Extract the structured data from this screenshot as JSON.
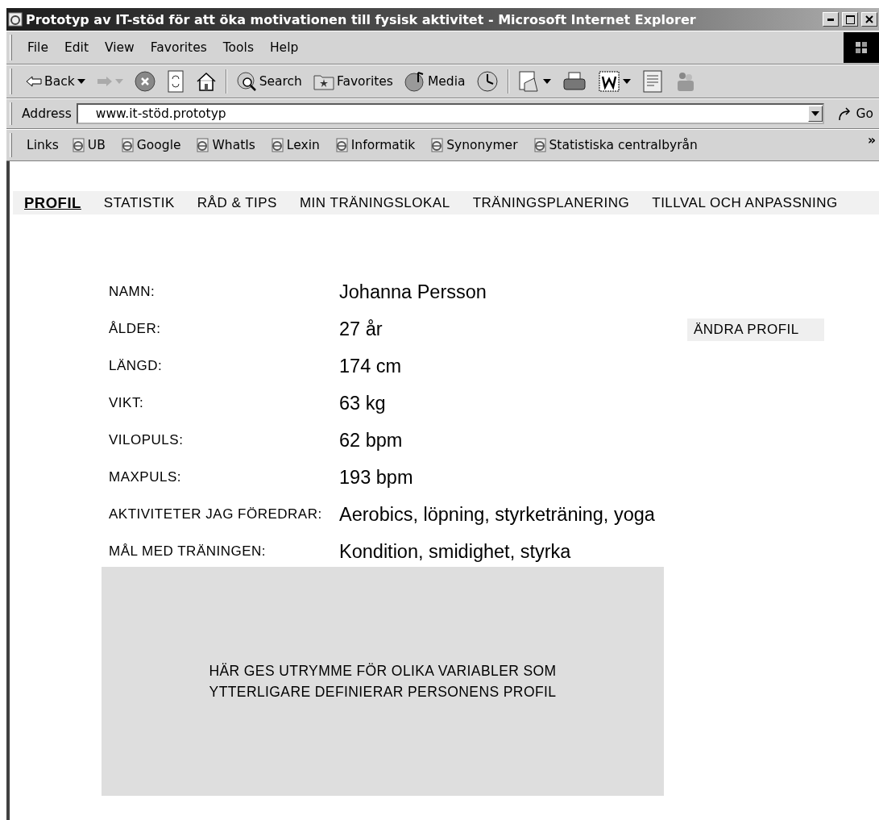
{
  "window": {
    "title": "Prototyp av IT-stöd för att öka motivationen till fysisk aktivitet - Microsoft Internet Explorer"
  },
  "menu_bar": [
    "File",
    "Edit",
    "View",
    "Favorites",
    "Tools",
    "Help"
  ],
  "toolbar": [
    {
      "kind": "back",
      "label": "Back"
    },
    {
      "kind": "forward"
    },
    {
      "kind": "stop"
    },
    {
      "kind": "refresh"
    },
    {
      "kind": "home"
    },
    {
      "kind": "separator"
    },
    {
      "kind": "search",
      "label": "Search"
    },
    {
      "kind": "favorites",
      "label": "Favorites"
    },
    {
      "kind": "media",
      "label": "Media"
    },
    {
      "kind": "history"
    },
    {
      "kind": "separator"
    },
    {
      "kind": "mail"
    },
    {
      "kind": "print"
    },
    {
      "kind": "word"
    },
    {
      "kind": "discuss"
    },
    {
      "kind": "messenger"
    }
  ],
  "address": {
    "label": "Address",
    "value": "www.it-stöd.prototyp",
    "go": "Go"
  },
  "links": {
    "label": "Links",
    "items": [
      "UB",
      "Google",
      "WhatIs",
      "Lexin",
      "Informatik",
      "Synonymer",
      "Statistiska centralbyrån"
    ],
    "more": "»"
  },
  "nav": [
    {
      "label": "PROFIL",
      "selected": true
    },
    {
      "label": "STATISTIK",
      "selected": false
    },
    {
      "label": "RÅD & TIPS",
      "selected": false
    },
    {
      "label": "MIN TRÄNINGSLOKAL",
      "selected": false
    },
    {
      "label": "TRÄNINGSPLANERING",
      "selected": false
    },
    {
      "label": "TILLVAL OCH ANPASSNING",
      "selected": false
    }
  ],
  "profile": [
    {
      "label": "NAMN:",
      "value": "Johanna Persson"
    },
    {
      "label": "ÅLDER:",
      "value": "27 år"
    },
    {
      "label": "LÄNGD:",
      "value": "174 cm"
    },
    {
      "label": "VIKT:",
      "value": "63 kg"
    },
    {
      "label": "VILOPULS:",
      "value": "62 bpm"
    },
    {
      "label": "MAXPULS:",
      "value": "193 bpm"
    },
    {
      "label": "AKTIVITETER JAG FÖREDRAR:",
      "value": "Aerobics, löpning, styrketräning, yoga"
    },
    {
      "label": "MÅL MED TRÄNINGEN:",
      "value": "Kondition, smidighet, styrka"
    }
  ],
  "edit_button": "ÄNDRA PROFIL",
  "panel_text": "HÄR GES UTRYMME FÖR OLIKA VARIABLER SOM YTTERLIGARE DEFINIERAR PERSONENS PROFIL"
}
